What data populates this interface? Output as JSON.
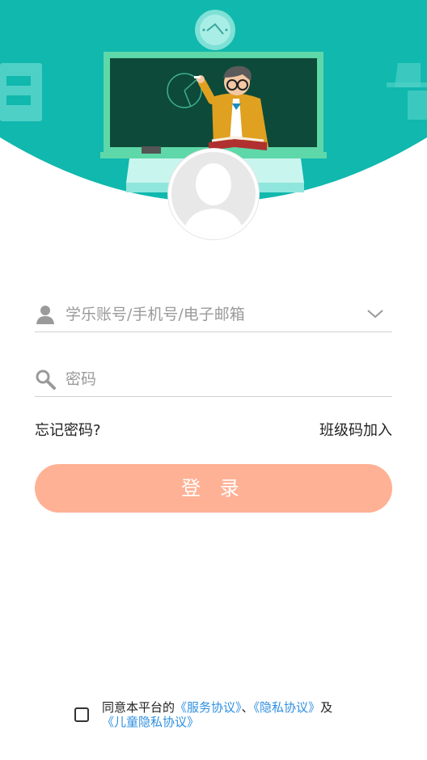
{
  "colors": {
    "header_teal": "#10b8ae",
    "login_button": "#ffb195",
    "link_blue": "#2f8fe0"
  },
  "icons": {
    "clock": "clock-icon",
    "user": "user-icon",
    "search": "search-icon",
    "chevron": "chevron-down-icon"
  },
  "login": {
    "account_placeholder": "学乐账号/手机号/电子邮箱",
    "password_placeholder": "密码",
    "forgot_password": "忘记密码?",
    "join_class": "班级码加入",
    "login_button": "登 录"
  },
  "agreement": {
    "prefix": "同意本平台的",
    "service": "《服务协议》",
    "sep": "、",
    "privacy": "《隐私协议》",
    "and": "及",
    "child_privacy": "《儿童隐私协议》"
  }
}
